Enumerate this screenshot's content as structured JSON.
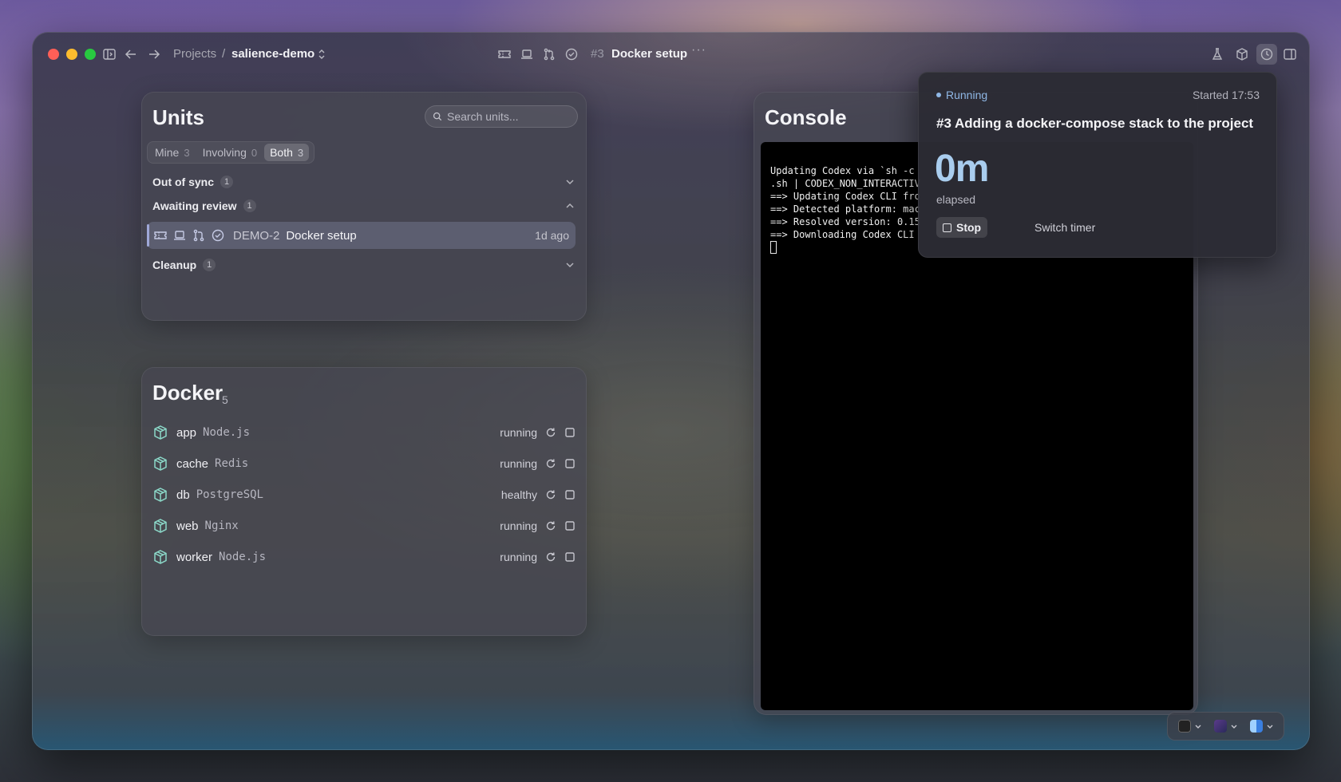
{
  "titlebar": {
    "breadcrumb_projects": "Projects",
    "breadcrumb_separator": "/",
    "project_name": "salience-demo",
    "unit_number": "#3",
    "unit_title": "Docker setup",
    "more": "···"
  },
  "units": {
    "title": "Units",
    "search_placeholder": "Search units...",
    "filters": [
      {
        "label": "Mine",
        "count": "3"
      },
      {
        "label": "Involving",
        "count": "0"
      },
      {
        "label": "Both",
        "count": "3",
        "active": true
      }
    ],
    "groups": [
      {
        "label": "Out of sync",
        "count": "1",
        "expanded": false
      },
      {
        "label": "Awaiting review",
        "count": "1",
        "expanded": true
      },
      {
        "label": "Cleanup",
        "count": "1",
        "expanded": false
      }
    ],
    "row": {
      "id": "DEMO-2",
      "title": "Docker setup",
      "time": "1d ago"
    }
  },
  "docker": {
    "title": "Docker",
    "count": "5",
    "services": [
      {
        "name": "app",
        "image": "Node.js",
        "status": "running"
      },
      {
        "name": "cache",
        "image": "Redis",
        "status": "running"
      },
      {
        "name": "db",
        "image": "PostgreSQL",
        "status": "healthy"
      },
      {
        "name": "web",
        "image": "Nginx",
        "status": "running"
      },
      {
        "name": "worker",
        "image": "Node.js",
        "status": "running"
      }
    ]
  },
  "console": {
    "title": "Console",
    "lines": [
      "Updating Codex via `sh -c",
      ".sh | CODEX_NON_INTERACTIV",
      "==> Updating Codex CLI fro",
      "==> Detected platform: mac",
      "==> Resolved version: 0.15",
      "==> Downloading Codex CLI"
    ]
  },
  "timer": {
    "status": "Running",
    "started": "Started 17:53",
    "title": "#3 Adding a docker-compose stack to the project",
    "elapsed_value": "0m",
    "elapsed_label": "elapsed",
    "stop_label": "Stop",
    "switch_label": "Switch timer"
  },
  "colors": {
    "accent_blue": "#a9cdee",
    "docker_icon": "#8bd8c8",
    "selected_row": "#9fa8d8"
  }
}
